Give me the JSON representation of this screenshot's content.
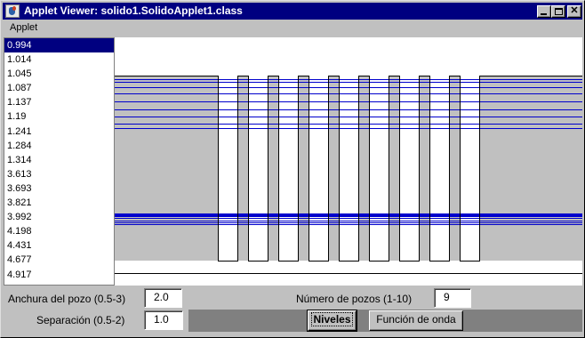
{
  "window": {
    "title": "Applet Viewer: solido1.SolidoApplet1.class",
    "minimize_icon": "minimize-icon",
    "maximize_icon": "maximize-icon",
    "close_glyph": "✕"
  },
  "menu": {
    "applet": "Applet"
  },
  "levels": {
    "selected_index": 0,
    "items": [
      "0.994",
      "1.014",
      "1.045",
      "1.087",
      "1.137",
      "1.19",
      "1.241",
      "1.284",
      "1.314",
      "3.613",
      "3.693",
      "3.821",
      "3.992",
      "4.198",
      "4.431",
      "4.677",
      "4.917"
    ]
  },
  "plot": {
    "well_count": 9,
    "level_color": "#0000cc",
    "barrier_color": "#c0c0c0",
    "well_color": "#ffffff"
  },
  "controls": {
    "anchura_label": "Anchura del pozo (0.5-3)",
    "anchura_value": "2.0",
    "numero_label": "Número de pozos (1-10)",
    "numero_value": "9",
    "separacion_label": "Separación (0.5-2)",
    "separacion_value": "1.0",
    "niveles_button": "Niveles",
    "onda_button": "Función de onda"
  }
}
